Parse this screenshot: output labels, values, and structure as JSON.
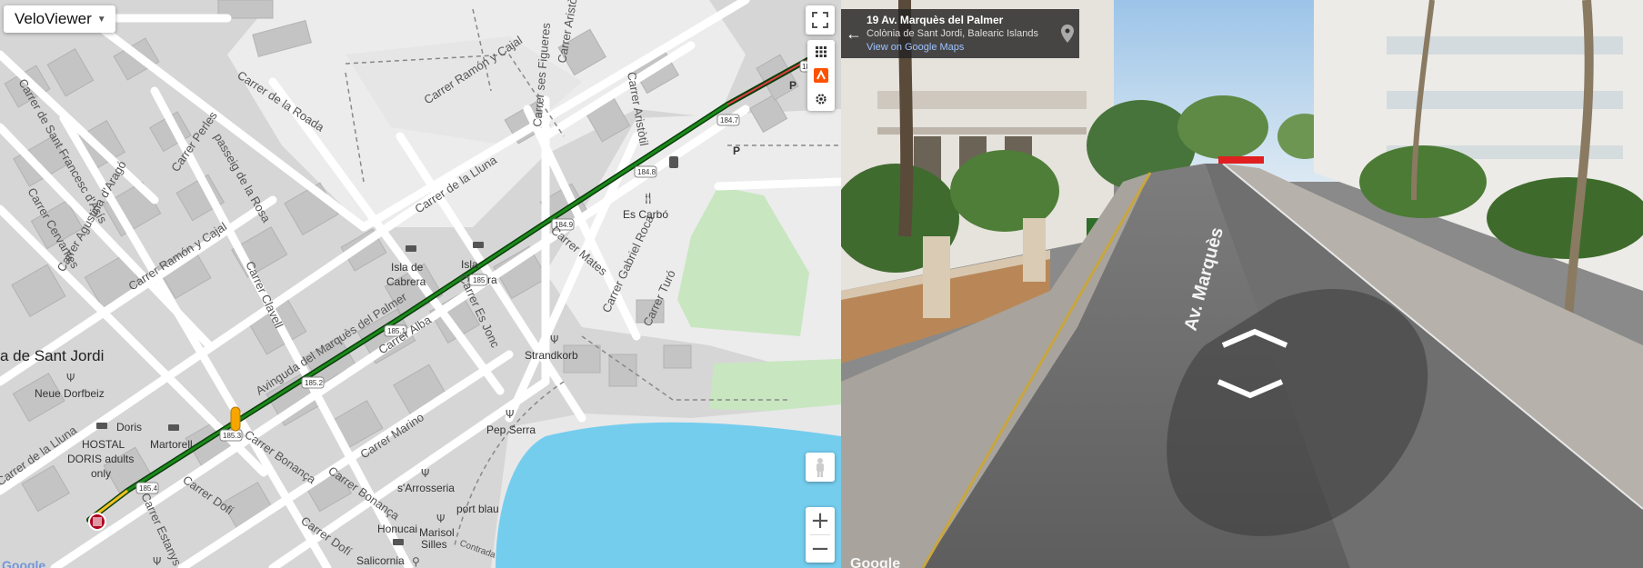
{
  "app": {
    "selector_label": "VeloViewer"
  },
  "map": {
    "streets": [
      "Carrer de la Roada",
      "Carrer Ramón y Cajal",
      "Carrer Aristòtil",
      "Carrer Aristòtil",
      "Carrer de Sant Francesc d'Asís",
      "Carrer Perles",
      "passeig de la Rosa",
      "Carrer Agustina d'Aragó",
      "Carrer Cervantes",
      "Carrer Ramón y Cajal",
      "Carrer de la Lluna",
      "Carrer ses Figueres",
      "Carrer Clavell",
      "Avinguda del Marquès del Palmer",
      "Carrer Mates",
      "Carrer Gabriel Roca",
      "Carrer Turó",
      "Carrer Es Jonc",
      "Carrer Alba",
      "Carrer Bonança",
      "Carrer Marino",
      "Carrer Bonança",
      "Carrer Dofí",
      "Carrer Estanys",
      "Carrer de la Lluna",
      "Carrer Dofí",
      "Contrada"
    ],
    "place": "a de Sant Jordi",
    "pois": {
      "es_carbo": "Es Carbó",
      "isla_cabrera_1": "Isla de",
      "isla_cabrera_2": "Cabrera",
      "isla_cabrera_b1": "Isla",
      "isla_cabrera_b2": "ra",
      "strandkorb": "Strandkorb",
      "neue_dorfbeiz": "Neue Dorfbeiz",
      "doris": "Doris",
      "martorell": "Martorell",
      "hostal_1": "HOSTAL",
      "hostal_2": "DORIS adults",
      "hostal_3": "only",
      "pep_serra": "Pep Serra",
      "sarrosseria": "s'Arrosseria",
      "port_blau": "port blau",
      "honucai": "Honucai",
      "marisol_1": "Marisol",
      "marisol_2": "Silles",
      "salicornia": "Salicornia",
      "parking_1": "P",
      "parking_2": "P"
    },
    "km_markers": [
      "184.7",
      "184.8",
      "184.9",
      "185",
      "185.1",
      "185.2",
      "185.3",
      "185.4",
      "18"
    ],
    "attribution": "Google"
  },
  "street_view": {
    "address_title": "19 Av. Marquès del Palmer",
    "address_sub": "Colònia de Sant Jordi, Balearic Islands",
    "maps_link": "View on Google Maps",
    "road_label": "Av. Marquès del",
    "attribution": "Google"
  },
  "colors": {
    "route": "#1a8a1a",
    "route_outline": "#0b3d0b",
    "water": "#75cdee",
    "park": "#c8e6c0",
    "building": "#c4c4c4",
    "accent_orange": "#f7a600"
  }
}
